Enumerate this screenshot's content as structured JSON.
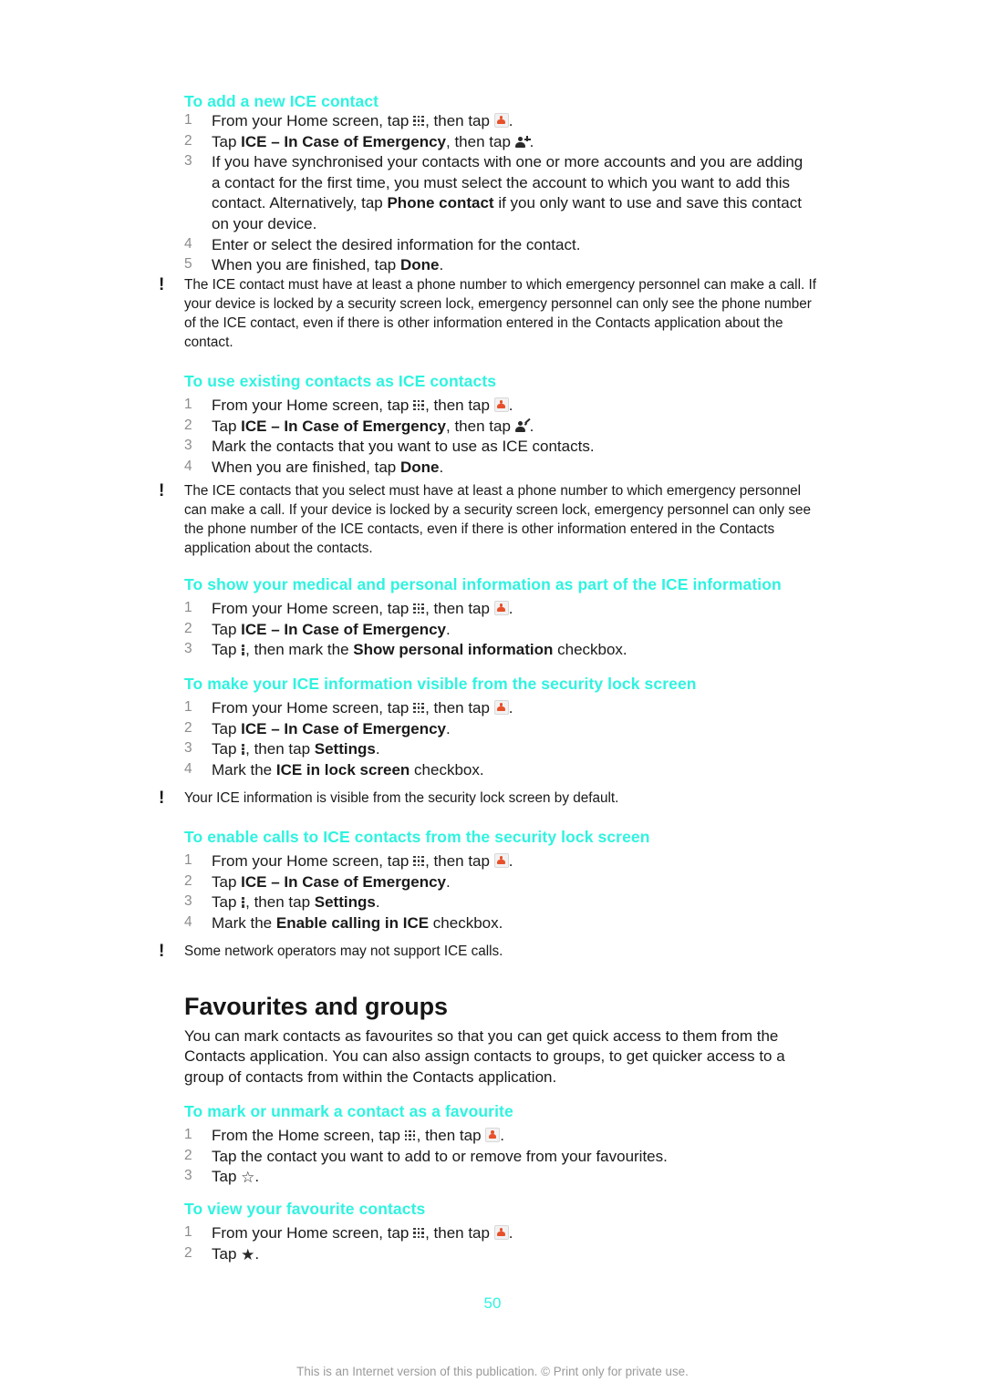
{
  "document": {
    "page_number": "50",
    "footer_note": "This is an Internet version of this publication. © Print only for private use.",
    "accent_color": "#2ff3e0"
  },
  "sections": {
    "add_ice": {
      "heading": "To add a new ICE contact",
      "steps": [
        {
          "pre": "From your Home screen, tap ",
          "icon1": "app-grid-icon",
          "mid": ", then tap ",
          "icon2": "contacts-icon",
          "post": "."
        },
        {
          "pre": "Tap ",
          "bold": "ICE – In Case of Emergency",
          "mid": ", then tap ",
          "icon2": "add-contact-icon",
          "post": "."
        },
        {
          "text_a": "If you have synchronised your contacts with one or more accounts and you are adding a contact for the first time, you must select the account to which you want to add this contact. Alternatively, tap ",
          "bold": "Phone contact",
          "text_b": " if you only want to use and save this contact on your device."
        },
        {
          "text": "Enter or select the desired information for the contact."
        },
        {
          "pre": "When you are finished, tap ",
          "bold": "Done",
          "post": "."
        }
      ],
      "note": "The ICE contact must have at least a phone number to which emergency personnel can make a call. If your device is locked by a security screen lock, emergency personnel can only see the phone number of the ICE contact, even if there is other information entered in the Contacts application about the contact."
    },
    "use_existing": {
      "heading": "To use existing contacts as ICE contacts",
      "steps": [
        {
          "pre": "From your Home screen, tap ",
          "icon1": "app-grid-icon",
          "mid": ", then tap ",
          "icon2": "contacts-icon",
          "post": "."
        },
        {
          "pre": "Tap ",
          "bold": "ICE – In Case of Emergency",
          "mid": ", then tap ",
          "icon2": "edit-contact-icon",
          "post": "."
        },
        {
          "text": "Mark the contacts that you want to use as ICE contacts."
        },
        {
          "pre": "When you are finished, tap ",
          "bold": "Done",
          "post": "."
        }
      ],
      "note": "The ICE contacts that you select must have at least a phone number to which emergency personnel can make a call. If your device is locked by a security screen lock, emergency personnel can only see the phone number of the ICE contacts, even if there is other information entered in the Contacts application about the contacts."
    },
    "show_medical": {
      "heading": "To show your medical and personal information as part of the ICE information",
      "steps": [
        {
          "pre": "From your Home screen, tap ",
          "icon1": "app-grid-icon",
          "mid": ", then tap ",
          "icon2": "contacts-icon",
          "post": "."
        },
        {
          "pre": "Tap ",
          "bold": "ICE – In Case of Emergency",
          "post": "."
        },
        {
          "pre": "Tap ",
          "icon1": "overflow-menu-icon",
          "mid": ", then mark the ",
          "bold": "Show personal information",
          "post": " checkbox."
        }
      ]
    },
    "lock_screen_visible": {
      "heading": "To make your ICE information visible from the security lock screen",
      "steps": [
        {
          "pre": "From your Home screen, tap ",
          "icon1": "app-grid-icon",
          "mid": ", then tap ",
          "icon2": "contacts-icon",
          "post": "."
        },
        {
          "pre": "Tap ",
          "bold": "ICE – In Case of Emergency",
          "post": "."
        },
        {
          "pre": "Tap ",
          "icon1": "overflow-menu-icon",
          "mid": ", then tap ",
          "bold": "Settings",
          "post": "."
        },
        {
          "pre": "Mark the ",
          "bold": "ICE in lock screen",
          "post": " checkbox."
        }
      ],
      "note": "Your ICE information is visible from the security lock screen by default."
    },
    "enable_calls": {
      "heading": "To enable calls to ICE contacts from the security lock screen",
      "steps": [
        {
          "pre": "From your Home screen, tap ",
          "icon1": "app-grid-icon",
          "mid": ", then tap ",
          "icon2": "contacts-icon",
          "post": "."
        },
        {
          "pre": "Tap ",
          "bold": "ICE – In Case of Emergency",
          "post": "."
        },
        {
          "pre": "Tap ",
          "icon1": "overflow-menu-icon",
          "mid": ", then tap ",
          "bold": "Settings",
          "post": "."
        },
        {
          "pre": "Mark the ",
          "bold": "Enable calling in ICE",
          "post": " checkbox."
        }
      ],
      "note": "Some network operators may not support ICE calls."
    },
    "favourites": {
      "heading": "Favourites and groups",
      "intro": "You can mark contacts as favourites so that you can get quick access to them from the Contacts application. You can also assign contacts to groups, to get quicker access to a group of contacts from within the Contacts application."
    },
    "mark_favourite": {
      "heading": "To mark or unmark a contact as a favourite",
      "steps": [
        {
          "pre": "From the Home screen, tap ",
          "icon1": "app-grid-icon",
          "mid": ", then tap ",
          "icon2": "contacts-icon",
          "post": "."
        },
        {
          "text": "Tap the contact you want to add to or remove from your favourites."
        },
        {
          "pre": "Tap ",
          "icon1": "star-outline-icon",
          "post": "."
        }
      ]
    },
    "view_favourites": {
      "heading": "To view your favourite contacts",
      "steps": [
        {
          "pre": "From your Home screen, tap ",
          "icon1": "app-grid-icon",
          "mid": ", then tap ",
          "icon2": "contacts-icon",
          "post": "."
        },
        {
          "pre": "Tap ",
          "icon1": "star-filled-icon",
          "post": "."
        }
      ]
    }
  },
  "icons": {
    "star_outline": "☆",
    "star_filled": "★",
    "note_marker": "!"
  }
}
